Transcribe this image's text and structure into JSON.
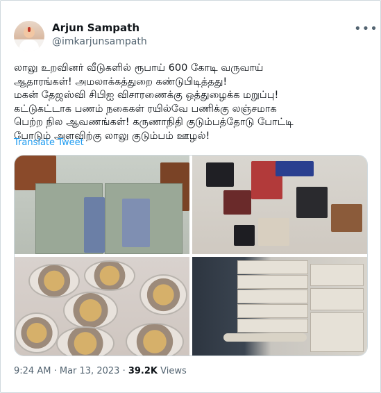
{
  "author": {
    "name": "Arjun Sampath",
    "handle": "@imkarjunsampath"
  },
  "tweet": {
    "lines": [
      "லாலு உறவினர் வீடுகளில் ரூபாய் 600 கோடி வருவாய்",
      "ஆதாரங்கள்! அமலாக்கத்துறை கண்டுபிடித்தது!",
      "மகன் தேஜஸ்வி சிபிஐ விசாரணைக்கு ஒத்துழைக்க மறுப்பு!",
      "கட்டுகட்டாக பணம் நகைகள் ரயில்வே பணிக்கு லஞ்சமாக",
      "பெற்ற நில ஆவணங்கள்! கருணாநிதி குடும்பத்தோடு போட்டி",
      "போடும் அளவிற்கு லாலு குடும்பம் ஊழல்!"
    ],
    "translate_label": "Translate Tweet"
  },
  "meta": {
    "time": "9:24 AM",
    "separator": "·",
    "date": "Mar 13, 2023",
    "separator2": "·",
    "views_count": "39.2K",
    "views_label": "Views"
  },
  "icons": {
    "more": "more-options-icon"
  },
  "colors": {
    "link": "#1d9bf0",
    "secondary_text": "#536471",
    "primary_text": "#0f1419",
    "border": "#cfd9de"
  }
}
